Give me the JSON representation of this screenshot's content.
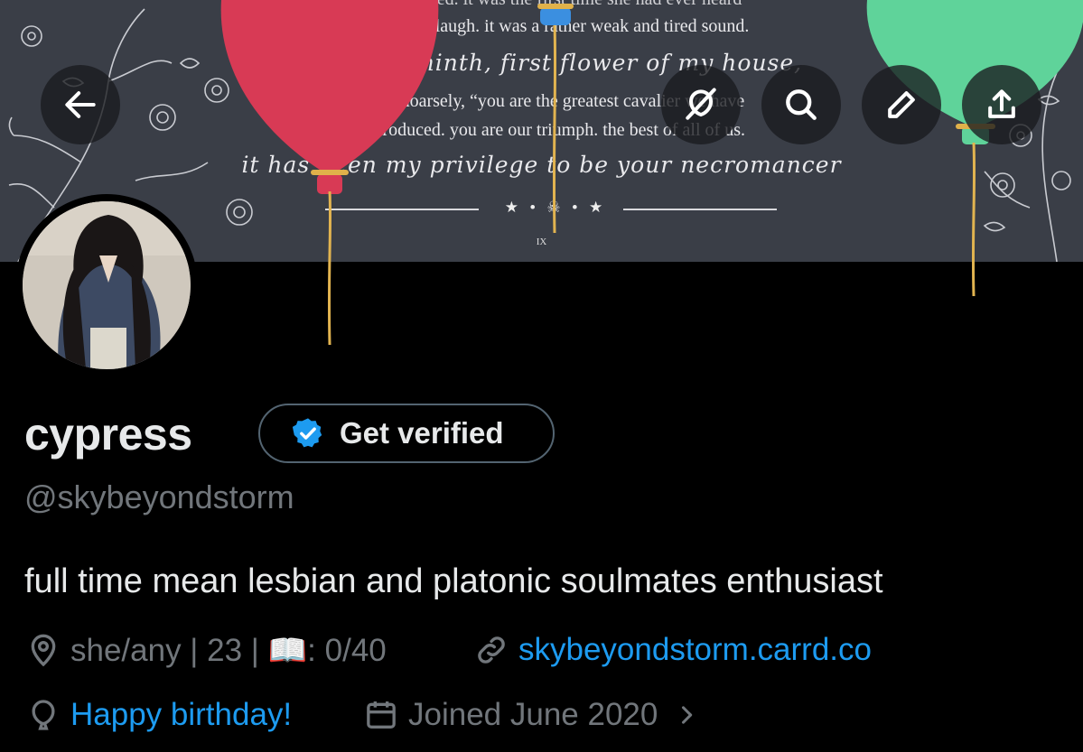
{
  "banner": {
    "quote_top_cut": "harrow laughed. it was the first time she had ever heard",
    "quote_line_1": "harrow really laugh. it was a rather weak and tired sound.",
    "quote_line_2": "gideon the ninth, first flower of my house,",
    "quote_line_3": "she said hoarsely, “you are the greatest cavalier we have",
    "quote_line_4": "ever produced. you are our triumph. the best of all of us.",
    "quote_line_5": "it has been my privilege to be your necromancer",
    "divider_mark": "★ • ☠ • ★",
    "numeral": "IX",
    "balloon_colors": {
      "red": "#d83a55",
      "blue": "#3b8fe0",
      "green": "#5fd39a"
    }
  },
  "header": {
    "back_icon": "arrow-left-icon",
    "icons": [
      "balloon-off-icon",
      "search-icon",
      "pencil-icon",
      "share-icon"
    ]
  },
  "profile": {
    "display_name": "cypress",
    "verify_label": "Get verified",
    "handle": "@skybeyondstorm",
    "bio": "full time mean lesbian and platonic soulmates enthusiast",
    "location": "she/any | 23 | 📖: 0/40",
    "website": "skybeyondstorm.carrd.co",
    "birthday": "Happy birthday!",
    "joined": "Joined June 2020"
  },
  "colors": {
    "background": "#000000",
    "text": "#e7e9ea",
    "muted": "#71767b",
    "link": "#1d9bf0",
    "border": "#536471",
    "banner": "#3a3e47"
  }
}
